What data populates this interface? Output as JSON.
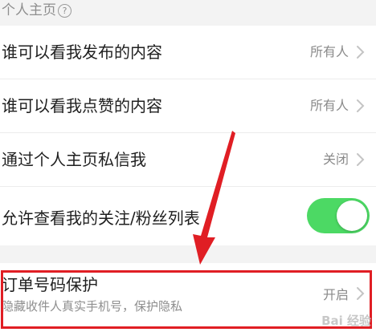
{
  "section": {
    "title": "个人主页",
    "help_icon": "?"
  },
  "rows": [
    {
      "label": "谁可以看我发布的内容",
      "value": "所有人"
    },
    {
      "label": "谁可以看我点赞的内容",
      "value": "所有人"
    },
    {
      "label": "通过个人主页私信我",
      "value": "关闭"
    },
    {
      "label": "允许查看我的关注/粉丝列表",
      "toggle": true
    }
  ],
  "order_protection": {
    "title": "订单号码保护",
    "subtitle": "隐藏收件人真实手机号，保护隐私",
    "value": "开启"
  },
  "colors": {
    "toggle_on": "#4cd964",
    "annotation_red": "#e01e24"
  },
  "watermark": "Bai 经验"
}
